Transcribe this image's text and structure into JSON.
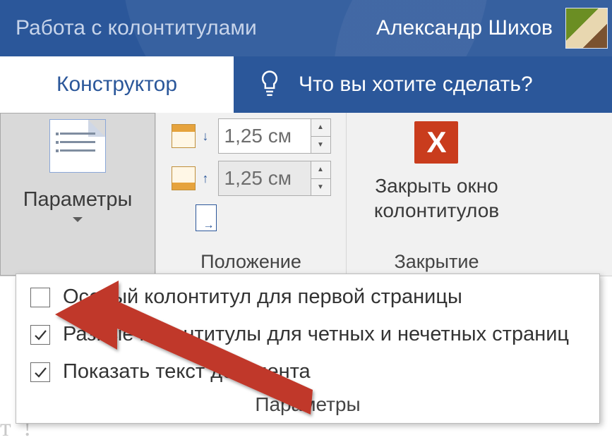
{
  "titlebar": {
    "context_title": "Работа с колонтитулами",
    "username": "Александр Шихов"
  },
  "tabs": {
    "active": "Конструктор",
    "tellme_placeholder": "Что вы хотите сделать?"
  },
  "ribbon": {
    "parameters": {
      "label": "Параметры"
    },
    "position": {
      "label": "Положение",
      "header_from_top": "1,25 см",
      "footer_from_bottom": "1,25 см"
    },
    "close": {
      "label": "Закрытие",
      "button_line1": "Закрыть окно",
      "button_line2": "колонтитулов"
    }
  },
  "popup": {
    "options": [
      {
        "label": "Особый колонтитул для первой страницы",
        "checked": false
      },
      {
        "label": "Разные колонтитулы для четных и нечетных страниц",
        "checked": true
      },
      {
        "label": "Показать текст документа",
        "checked": true
      }
    ],
    "footer": "Параметры"
  }
}
